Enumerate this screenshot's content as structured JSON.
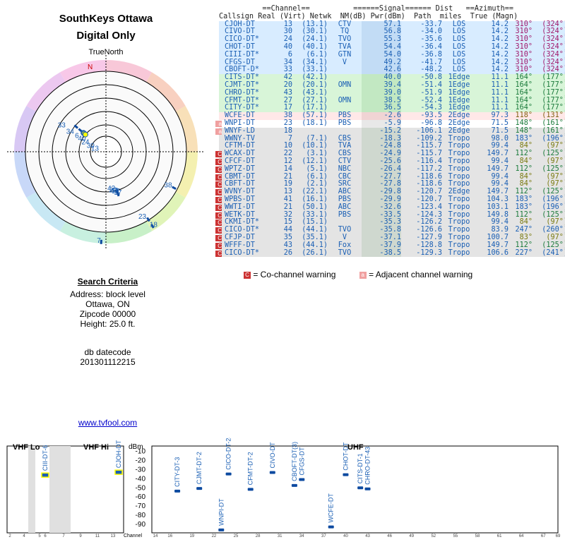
{
  "title": "SouthKeys Ottawa",
  "subtitle": "Digital Only",
  "polar": {
    "north_label": "TrueNorth",
    "n_letter": "N"
  },
  "criteria": {
    "heading": "Search Criteria",
    "address": "Address: block level",
    "city": "Ottawa, ON",
    "zip": "Zipcode 00000",
    "height": "Height: 25.0 ft.",
    "db_label": "db datecode",
    "db_code": "201301112215"
  },
  "link": "www.tvfool.com",
  "table": {
    "header1": "          ==Channel==          ======Signal====== Dist   ==Azimuth==",
    "header2": "Callsign Real (Virt) Netwk  NM(dB) Pwr(dBm)  Path  miles  True (Magn)",
    "rows": [
      {
        "call": "CJOH-DT",
        "real": "13",
        "virt": "(13.1)",
        "net": "CTV",
        "nm": "57.1",
        "pwr": "-33.7",
        "path": "LOS",
        "dist": "14.2",
        "true": "310°",
        "magn": "(324°)",
        "bg": "#d8ecff",
        "warn": ""
      },
      {
        "call": "CIVO-DT",
        "real": "30",
        "virt": "(30.1)",
        "net": "TQ",
        "nm": "56.8",
        "pwr": "-34.0",
        "path": "LOS",
        "dist": "14.2",
        "true": "310°",
        "magn": "(324°)",
        "bg": "#d8ecff",
        "warn": ""
      },
      {
        "call": "CICO-DT*",
        "real": "24",
        "virt": "(24.1)",
        "net": "TVO",
        "nm": "55.3",
        "pwr": "-35.6",
        "path": "LOS",
        "dist": "14.2",
        "true": "310°",
        "magn": "(324°)",
        "bg": "#d8ecff",
        "warn": ""
      },
      {
        "call": "CHOT-DT",
        "real": "40",
        "virt": "(40.1)",
        "net": "TVA",
        "nm": "54.4",
        "pwr": "-36.4",
        "path": "LOS",
        "dist": "14.2",
        "true": "310°",
        "magn": "(324°)",
        "bg": "#d8ecff",
        "warn": ""
      },
      {
        "call": "CIII-DT*",
        "real": "6",
        "virt": "(6.1)",
        "net": "GTN",
        "nm": "54.0",
        "pwr": "-36.8",
        "path": "LOS",
        "dist": "14.2",
        "true": "310°",
        "magn": "(324°)",
        "bg": "#d8ecff",
        "warn": ""
      },
      {
        "call": "CFGS-DT",
        "real": "34",
        "virt": "(34.1)",
        "net": "V",
        "nm": "49.2",
        "pwr": "-41.7",
        "path": "LOS",
        "dist": "14.2",
        "true": "310°",
        "magn": "(324°)",
        "bg": "#d8ecff",
        "warn": ""
      },
      {
        "call": "CBOFT-D*",
        "real": "33",
        "virt": "(33.1)",
        "net": "",
        "nm": "42.6",
        "pwr": "-48.2",
        "path": "LOS",
        "dist": "14.2",
        "true": "310°",
        "magn": "(324°)",
        "bg": "#d8ecff",
        "warn": ""
      },
      {
        "call": "CITS-DT*",
        "real": "42",
        "virt": "(42.1)",
        "net": "",
        "nm": "40.0",
        "pwr": "-50.8",
        "path": "1Edge",
        "dist": "11.1",
        "true": "164°",
        "magn": "(177°)",
        "bg": "#d8f5d8",
        "warn": ""
      },
      {
        "call": "CJMT-DT*",
        "real": "20",
        "virt": "(20.1)",
        "net": "OMN",
        "nm": "39.4",
        "pwr": "-51.4",
        "path": "1Edge",
        "dist": "11.1",
        "true": "164°",
        "magn": "(177°)",
        "bg": "#d8f5d8",
        "warn": ""
      },
      {
        "call": "CHRO-DT*",
        "real": "43",
        "virt": "(43.1)",
        "net": "",
        "nm": "39.0",
        "pwr": "-51.9",
        "path": "1Edge",
        "dist": "11.1",
        "true": "164°",
        "magn": "(177°)",
        "bg": "#d8f5d8",
        "warn": ""
      },
      {
        "call": "CFMT-DT*",
        "real": "27",
        "virt": "(27.1)",
        "net": "OMN",
        "nm": "38.5",
        "pwr": "-52.4",
        "path": "1Edge",
        "dist": "11.1",
        "true": "164°",
        "magn": "(177°)",
        "bg": "#d8f5d8",
        "warn": ""
      },
      {
        "call": "CITY-DT*",
        "real": "17",
        "virt": "(17.1)",
        "net": "",
        "nm": "36.5",
        "pwr": "-54.3",
        "path": "1Edge",
        "dist": "11.1",
        "true": "164°",
        "magn": "(177°)",
        "bg": "#d8f5d8",
        "warn": ""
      },
      {
        "call": "WCFE-DT",
        "real": "38",
        "virt": "(57.1)",
        "net": "PBS",
        "nm": "-2.6",
        "pwr": "-93.5",
        "path": "2Edge",
        "dist": "97.3",
        "true": "118°",
        "magn": "(131°)",
        "bg": "#ffe8e8",
        "warn": ""
      },
      {
        "call": "WNPI-DT",
        "real": "23",
        "virt": "(18.1)",
        "net": "PBS",
        "nm": "-5.9",
        "pwr": "-96.8",
        "path": "2Edge",
        "dist": "71.5",
        "true": "148°",
        "magn": "(161°)",
        "bg": "#ffffff",
        "warn": "adj"
      },
      {
        "call": "WNYF-LD",
        "real": "18",
        "virt": "",
        "net": "",
        "nm": "-15.2",
        "pwr": "-106.1",
        "path": "2Edge",
        "dist": "71.5",
        "true": "148°",
        "magn": "(161°)",
        "bg": "#e4e4e4",
        "warn": "adj"
      },
      {
        "call": "WWNY-TV",
        "real": "7",
        "virt": "(7.1)",
        "net": "CBS",
        "nm": "-18.3",
        "pwr": "-109.2",
        "path": "Tropo",
        "dist": "98.0",
        "true": "183°",
        "magn": "(196°)",
        "bg": "#e4e4e4",
        "warn": ""
      },
      {
        "call": "CFTM-DT",
        "real": "10",
        "virt": "(10.1)",
        "net": "TVA",
        "nm": "-24.8",
        "pwr": "-115.7",
        "path": "Tropo",
        "dist": "99.4",
        "true": "84°",
        "magn": "(97°)",
        "bg": "#e4e4e4",
        "warn": ""
      },
      {
        "call": "WCAX-DT",
        "real": "22",
        "virt": "(3.1)",
        "net": "CBS",
        "nm": "-24.9",
        "pwr": "-115.7",
        "path": "Tropo",
        "dist": "149.7",
        "true": "112°",
        "magn": "(125°)",
        "bg": "#e4e4e4",
        "warn": "co"
      },
      {
        "call": "CFCF-DT",
        "real": "12",
        "virt": "(12.1)",
        "net": "CTV",
        "nm": "-25.6",
        "pwr": "-116.4",
        "path": "Tropo",
        "dist": "99.4",
        "true": "84°",
        "magn": "(97°)",
        "bg": "#e4e4e4",
        "warn": "co"
      },
      {
        "call": "WPTZ-DT",
        "real": "14",
        "virt": "(5.1)",
        "net": "NBC",
        "nm": "-26.4",
        "pwr": "-117.2",
        "path": "Tropo",
        "dist": "149.7",
        "true": "112°",
        "magn": "(125°)",
        "bg": "#e4e4e4",
        "warn": "co"
      },
      {
        "call": "CBMT-DT",
        "real": "21",
        "virt": "(6.1)",
        "net": "CBC",
        "nm": "-27.7",
        "pwr": "-118.6",
        "path": "Tropo",
        "dist": "99.4",
        "true": "84°",
        "magn": "(97°)",
        "bg": "#e4e4e4",
        "warn": "co"
      },
      {
        "call": "CBFT-DT",
        "real": "19",
        "virt": "(2.1)",
        "net": "SRC",
        "nm": "-27.8",
        "pwr": "-118.6",
        "path": "Tropo",
        "dist": "99.4",
        "true": "84°",
        "magn": "(97°)",
        "bg": "#e4e4e4",
        "warn": "co"
      },
      {
        "call": "WVNY-DT",
        "real": "13",
        "virt": "(22.1)",
        "net": "ABC",
        "nm": "-29.8",
        "pwr": "-120.7",
        "path": "2Edge",
        "dist": "149.7",
        "true": "112°",
        "magn": "(125°)",
        "bg": "#e4e4e4",
        "warn": "co"
      },
      {
        "call": "WPBS-DT",
        "real": "41",
        "virt": "(16.1)",
        "net": "PBS",
        "nm": "-29.9",
        "pwr": "-120.7",
        "path": "Tropo",
        "dist": "104.3",
        "true": "183°",
        "magn": "(196°)",
        "bg": "#e4e4e4",
        "warn": "co"
      },
      {
        "call": "WWTI-DT",
        "real": "21",
        "virt": "(50.1)",
        "net": "ABC",
        "nm": "-32.6",
        "pwr": "-123.4",
        "path": "Tropo",
        "dist": "103.1",
        "true": "183°",
        "magn": "(196°)",
        "bg": "#e4e4e4",
        "warn": "co"
      },
      {
        "call": "WETK-DT",
        "real": "32",
        "virt": "(33.1)",
        "net": "PBS",
        "nm": "-33.5",
        "pwr": "-124.3",
        "path": "Tropo",
        "dist": "149.8",
        "true": "112°",
        "magn": "(125°)",
        "bg": "#e4e4e4",
        "warn": "co"
      },
      {
        "call": "CKMI-DT*",
        "real": "15",
        "virt": "(15.1)",
        "net": "",
        "nm": "-35.3",
        "pwr": "-126.2",
        "path": "Tropo",
        "dist": "99.4",
        "true": "84°",
        "magn": "(97°)",
        "bg": "#e4e4e4",
        "warn": "co"
      },
      {
        "call": "CICO-DT*",
        "real": "44",
        "virt": "(44.1)",
        "net": "TVO",
        "nm": "-35.8",
        "pwr": "-126.6",
        "path": "Tropo",
        "dist": "83.9",
        "true": "247°",
        "magn": "(260°)",
        "bg": "#e4e4e4",
        "warn": "co"
      },
      {
        "call": "CFJP-DT",
        "real": "35",
        "virt": "(35.1)",
        "net": "V",
        "nm": "-37.1",
        "pwr": "-127.9",
        "path": "Tropo",
        "dist": "100.7",
        "true": "83°",
        "magn": "(97°)",
        "bg": "#e4e4e4",
        "warn": "co"
      },
      {
        "call": "WFFF-DT",
        "real": "43",
        "virt": "(44.1)",
        "net": "Fox",
        "nm": "-37.9",
        "pwr": "-128.8",
        "path": "Tropo",
        "dist": "149.7",
        "true": "112°",
        "magn": "(125°)",
        "bg": "#e4e4e4",
        "warn": "co"
      },
      {
        "call": "CICO-DT*",
        "real": "26",
        "virt": "(26.1)",
        "net": "TVO",
        "nm": "-38.5",
        "pwr": "-129.3",
        "path": "Tropo",
        "dist": "106.6",
        "true": "227°",
        "magn": "(241°)",
        "bg": "#e4e4e4",
        "warn": "co"
      }
    ]
  },
  "legend": {
    "co_letter": "C",
    "co_text": "= Co-channel warning",
    "adj_letter": "a",
    "adj_text": "= Adjacent channel warning"
  },
  "chart_data": {
    "type": "bar",
    "sections": {
      "vhf_lo": "VHF Lo",
      "vhf_hi": "VHF Hi",
      "uhf": "UHF"
    },
    "ylabel": "dBm",
    "xlabel": "Channel",
    "ylim": [
      -100,
      -10
    ],
    "yticks": [
      "-10",
      "-20",
      "-30",
      "-40",
      "-50",
      "-60",
      "-70",
      "-80",
      "-90"
    ],
    "vhf_ticks": [
      "2",
      "4",
      "5",
      "6",
      "7",
      "9",
      "11",
      "13"
    ],
    "uhf_ticks": [
      "14",
      "16",
      "19",
      "22",
      "25",
      "28",
      "31",
      "34",
      "37",
      "40",
      "43",
      "46",
      "49",
      "52",
      "55",
      "58",
      "61",
      "64",
      "67",
      "69"
    ],
    "stations": [
      {
        "label": "CIII-DT-6",
        "ch": 6,
        "dbm": -36.8
      },
      {
        "label": "CJOH-DT",
        "ch": 13,
        "dbm": -33.7
      },
      {
        "label": "CITY-DT-3",
        "ch": 17,
        "dbm": -54.3
      },
      {
        "label": "CJMT-DT-2",
        "ch": 20,
        "dbm": -51.4
      },
      {
        "label": "WNPI-DT",
        "ch": 23,
        "dbm": -96.8
      },
      {
        "label": "CICO-DT-24",
        "ch": 24,
        "dbm": -35.6
      },
      {
        "label": "CFMT-DT-2",
        "ch": 27,
        "dbm": -52.4
      },
      {
        "label": "CIVO-DT",
        "ch": 30,
        "dbm": -34.0
      },
      {
        "label": "CBOFT-DT(3)",
        "ch": 33,
        "dbm": -48.2
      },
      {
        "label": "CFGS-DT",
        "ch": 34,
        "dbm": -41.7
      },
      {
        "label": "WCFE-DT",
        "ch": 38,
        "dbm": -93.5
      },
      {
        "label": "CHOT-DT",
        "ch": 40,
        "dbm": -36.4
      },
      {
        "label": "CITS-DT-1",
        "ch": 42,
        "dbm": -50.8
      },
      {
        "label": "CHRO-DT-43",
        "ch": 43,
        "dbm": -51.9
      }
    ]
  },
  "polar_stations": [
    {
      "label": "33",
      "az": 310,
      "nm": 42.6
    },
    {
      "label": "34",
      "az": 310,
      "nm": 49.2
    },
    {
      "label": "6",
      "az": 310,
      "nm": 54.0
    },
    {
      "label": "40",
      "az": 310,
      "nm": 54.4
    },
    {
      "label": "24",
      "az": 310,
      "nm": 55.3
    },
    {
      "label": "30",
      "az": 310,
      "nm": 56.8
    },
    {
      "label": "13",
      "az": 310,
      "nm": 57.1
    },
    {
      "label": "38",
      "az": 118,
      "nm": -2.6
    },
    {
      "label": "42",
      "az": 164,
      "nm": 40.0
    },
    {
      "label": "20",
      "az": 164,
      "nm": 39.4
    },
    {
      "label": "43",
      "az": 164,
      "nm": 39.0
    },
    {
      "label": "27",
      "az": 164,
      "nm": 38.5
    },
    {
      "label": "17",
      "az": 164,
      "nm": 36.5
    },
    {
      "label": "23",
      "az": 148,
      "nm": -5.9
    },
    {
      "label": "18",
      "az": 148,
      "nm": -15.2
    },
    {
      "label": "7",
      "az": 183,
      "nm": -18.3
    }
  ],
  "colors": {
    "blue": "#1a5fb4",
    "uhf_bar": "#0d4aa0",
    "highlight": "#ffff00",
    "co_warn": "#cc3333",
    "adj_warn": "#f0a0a0"
  }
}
